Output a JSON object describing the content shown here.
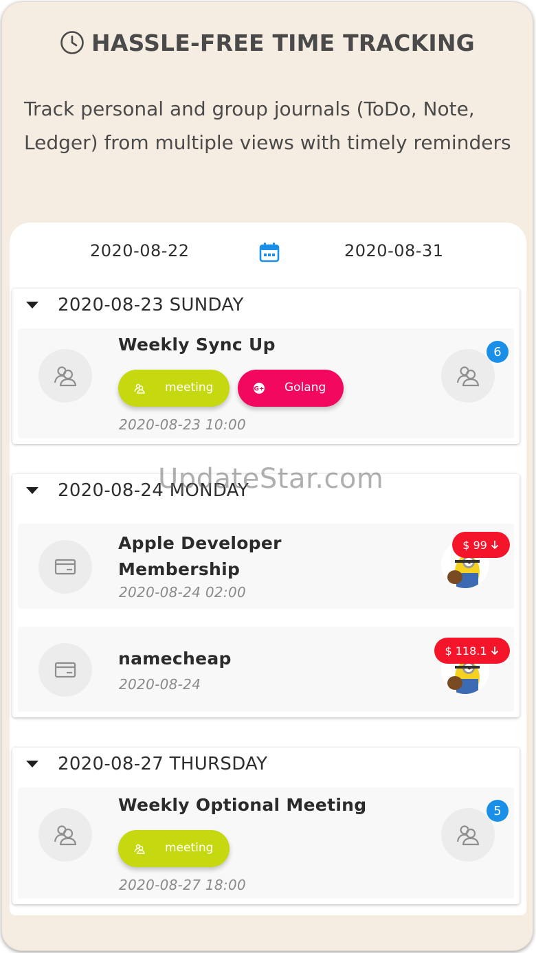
{
  "header": {
    "title": "HASSLE-FREE TIME TRACKING",
    "title_icon": "clock-icon",
    "subtitle": "Track personal and group journals (ToDo, Note, Ledger) from multiple views with timely reminders"
  },
  "date_range": {
    "start": "2020-08-22",
    "end": "2020-08-31",
    "icon": "calendar-icon",
    "icon_color": "#1a8fe8"
  },
  "sections": [
    {
      "title": "2020-08-23 SUNDAY",
      "items": [
        {
          "title": "Weekly Sync Up",
          "date": "2020-08-23 10:00",
          "icon": "group-icon",
          "tags": [
            {
              "label": "meeting",
              "icon": "group-icon",
              "color": "#c6d80f"
            },
            {
              "label": "Golang",
              "icon": "g-plus-icon",
              "color": "#f2085f"
            }
          ],
          "participants_count": "6"
        }
      ]
    },
    {
      "title": "2020-08-24 MONDAY",
      "items": [
        {
          "title_line1": "Apple Developer",
          "title_line2": "Membership",
          "date": "2020-08-24 02:00",
          "icon": "credit-card-icon",
          "amount": "$ 99",
          "amount_icon": "arrow-down-icon"
        },
        {
          "title": "namecheap",
          "date": "2020-08-24",
          "icon": "credit-card-icon",
          "amount": "$ 118.1",
          "amount_icon": "arrow-down-icon"
        }
      ]
    },
    {
      "title": "2020-08-27 THURSDAY",
      "items": [
        {
          "title": "Weekly Optional Meeting",
          "date": "2020-08-27 18:00",
          "icon": "group-icon",
          "tags": [
            {
              "label": "meeting",
              "icon": "group-icon",
              "color": "#c6d80f"
            }
          ],
          "participants_count": "5"
        }
      ]
    }
  ],
  "watermark": "UpdateStar.com",
  "colors": {
    "background": "#f6ede2",
    "badge_blue": "#1a8fe8",
    "amount_red": "#f4152a"
  }
}
